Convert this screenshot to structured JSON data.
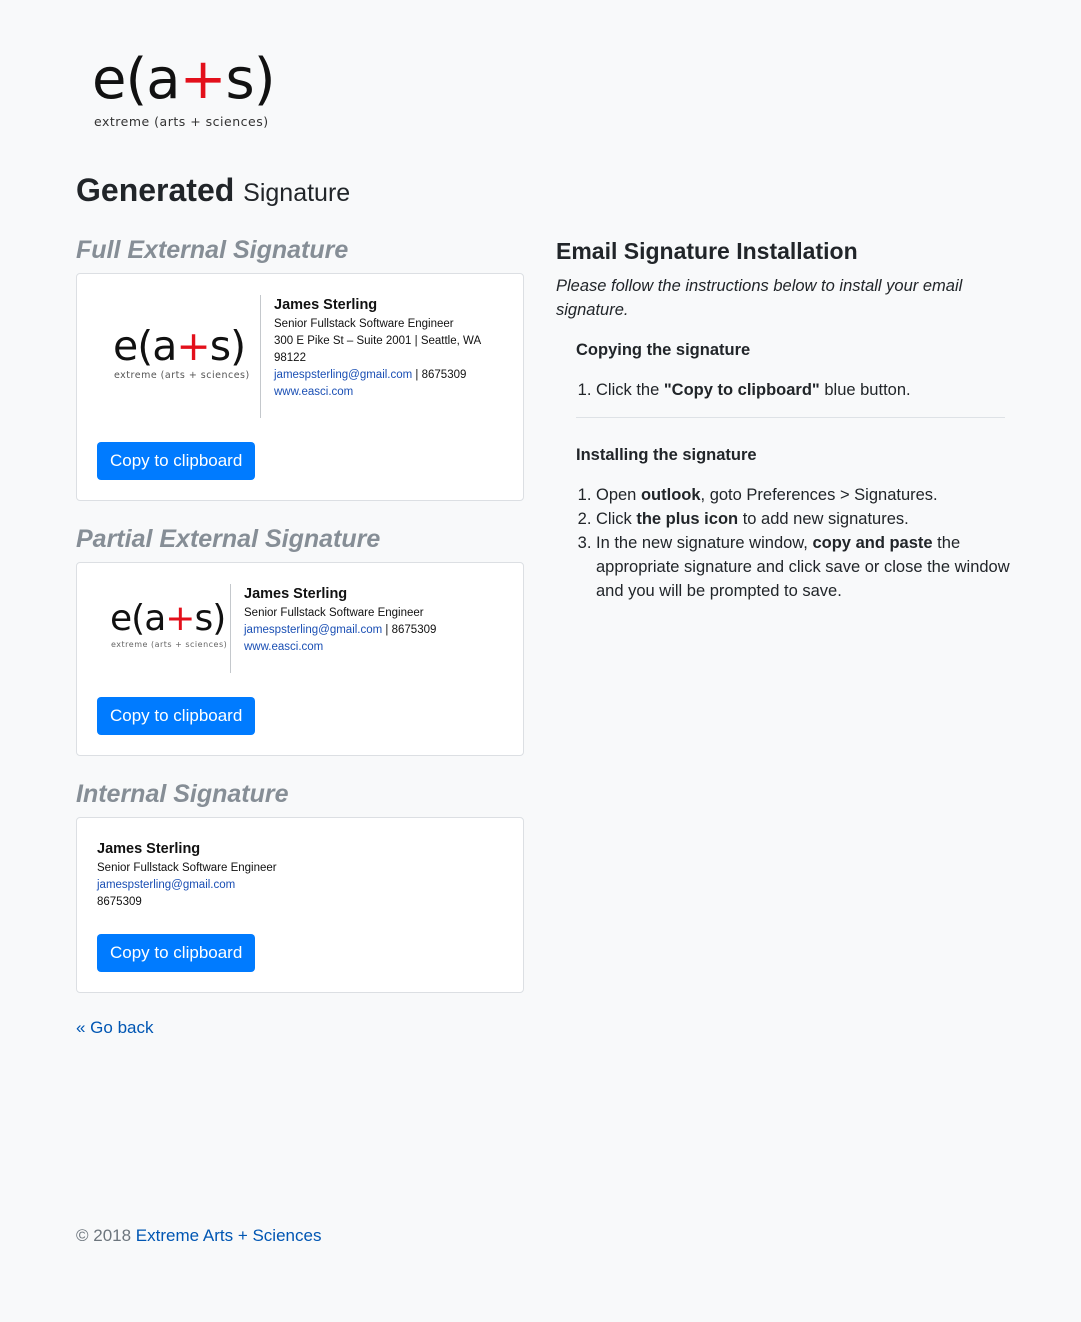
{
  "brand": {
    "logo_word_prefix": "e(a",
    "logo_word_plus": "+",
    "logo_word_suffix": "s)",
    "tagline": "extreme (arts + sciences)",
    "accent_color": "#e3101b"
  },
  "page_title": {
    "main": "Generated",
    "sub": "Signature"
  },
  "signatures": {
    "full": {
      "heading": "Full External Signature",
      "name": "James Sterling",
      "title": "Senior Fullstack Software Engineer",
      "address": "300 E Pike St – Suite 2001 | Seattle, WA 98122",
      "email": "jamespsterling@gmail.com",
      "phone_suffix": " | 8675309",
      "website": "www.easci.com",
      "button": "Copy to clipboard"
    },
    "partial": {
      "heading": "Partial External Signature",
      "name": "James Sterling",
      "title": "Senior Fullstack Software Engineer",
      "email": "jamespsterling@gmail.com",
      "phone_suffix": " | 8675309",
      "website": "www.easci.com",
      "button": "Copy to clipboard"
    },
    "internal": {
      "heading": "Internal Signature",
      "name": "James Sterling",
      "title": "Senior Fullstack Software Engineer",
      "email": "jamespsterling@gmail.com",
      "phone": "8675309",
      "button": "Copy to clipboard"
    }
  },
  "instructions": {
    "heading": "Email Signature Installation",
    "intro": "Please follow the instructions below to install your email signature.",
    "copying": {
      "title": "Copying the signature",
      "step1_pre": "Click the ",
      "step1_bold": "\"Copy to clipboard\"",
      "step1_post": " blue button."
    },
    "installing": {
      "title": "Installing the signature",
      "step1_pre": "Open ",
      "step1_bold": "outlook",
      "step1_post": ", goto Preferences > Signatures.",
      "step2_pre": "Click ",
      "step2_bold": "the plus icon",
      "step2_post": " to add new signatures.",
      "step3_pre": "In the new signature window, ",
      "step3_bold": "copy and paste",
      "step3_post": " the appropriate signature and click save or close the window and you will be prompted to save."
    }
  },
  "go_back": "« Go back",
  "footer": {
    "copyright": "© 2018 ",
    "link": "Extreme Arts + Sciences"
  },
  "colors": {
    "button": "#007bff",
    "link": "#0056b3",
    "muted_heading": "#868e96"
  }
}
